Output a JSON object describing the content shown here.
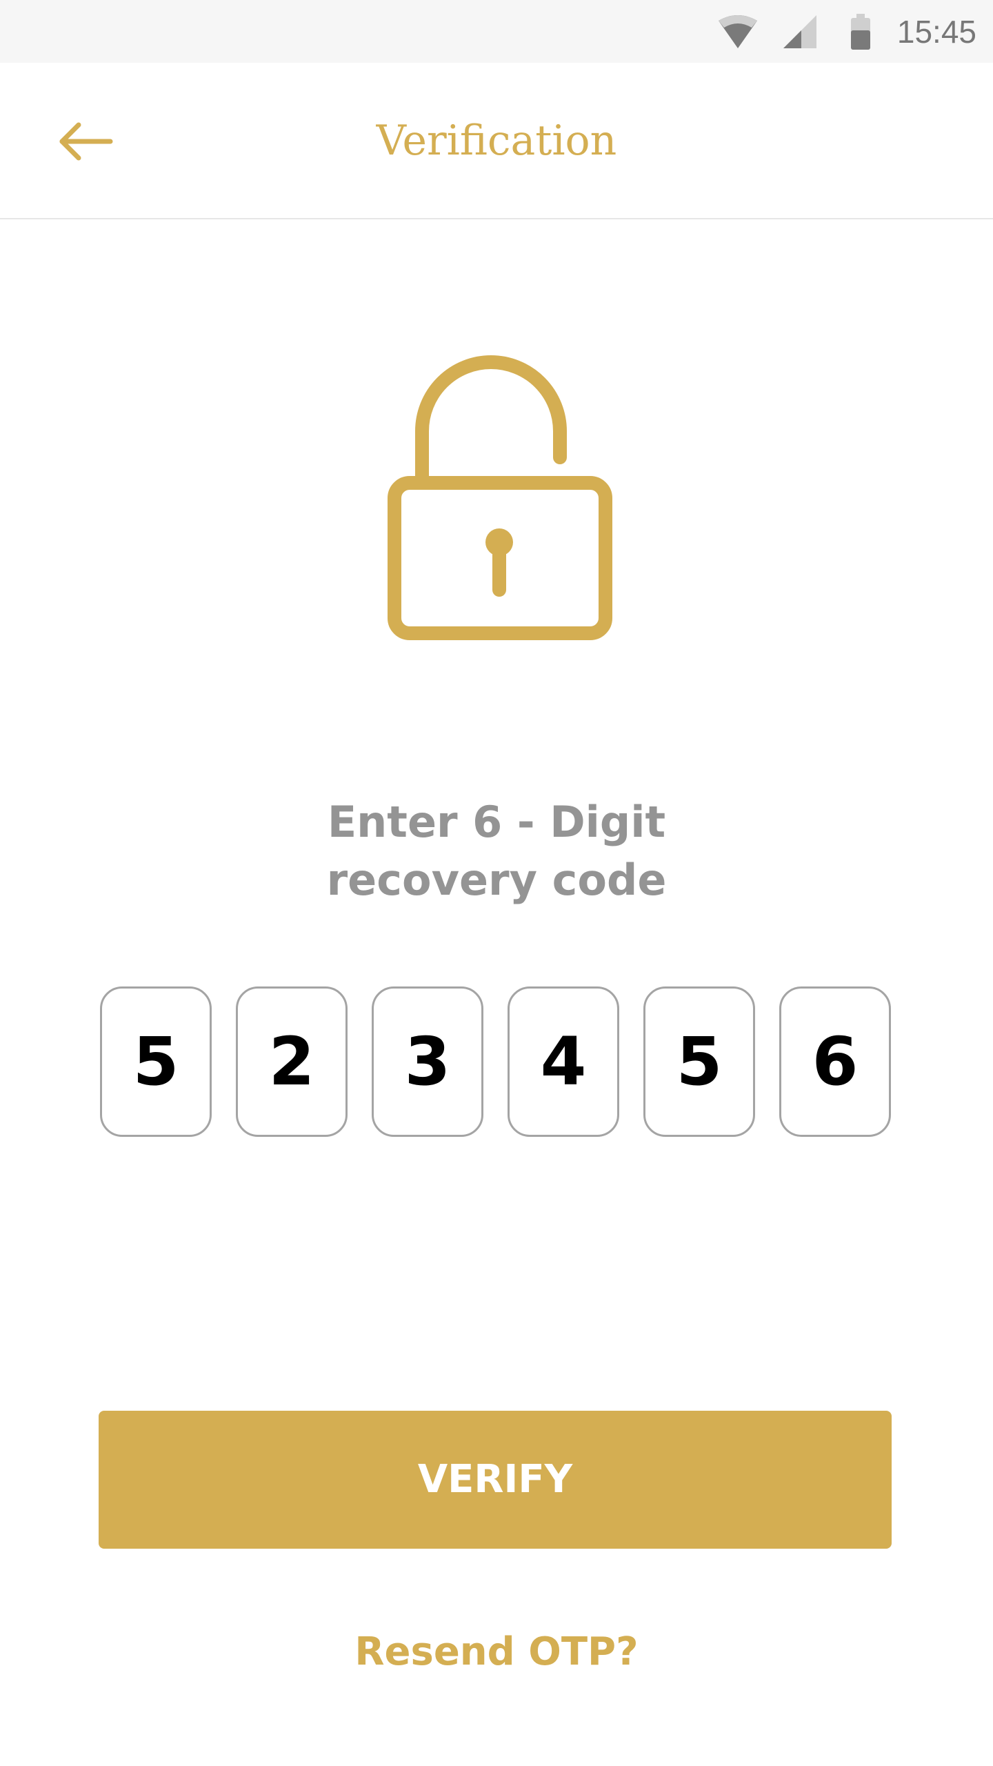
{
  "status_bar": {
    "time": "15:45",
    "icons": [
      "wifi-icon",
      "cellular-signal-icon",
      "battery-icon"
    ]
  },
  "header": {
    "back_icon": "arrow-left-icon",
    "title": "Verification"
  },
  "illustration": {
    "icon": "padlock-open-icon"
  },
  "instruction": {
    "line1": "Enter 6 - Digit",
    "line2": "recovery code"
  },
  "otp": {
    "digits": [
      "5",
      "2",
      "3",
      "4",
      "5",
      "6"
    ]
  },
  "actions": {
    "verify_label": "VERIFY",
    "resend_label": "Resend OTP?"
  },
  "colors": {
    "accent": "#d4ae52",
    "muted_text": "#949494",
    "box_border": "#a4a4a4",
    "status_bar_bg": "#f6f6f6"
  }
}
